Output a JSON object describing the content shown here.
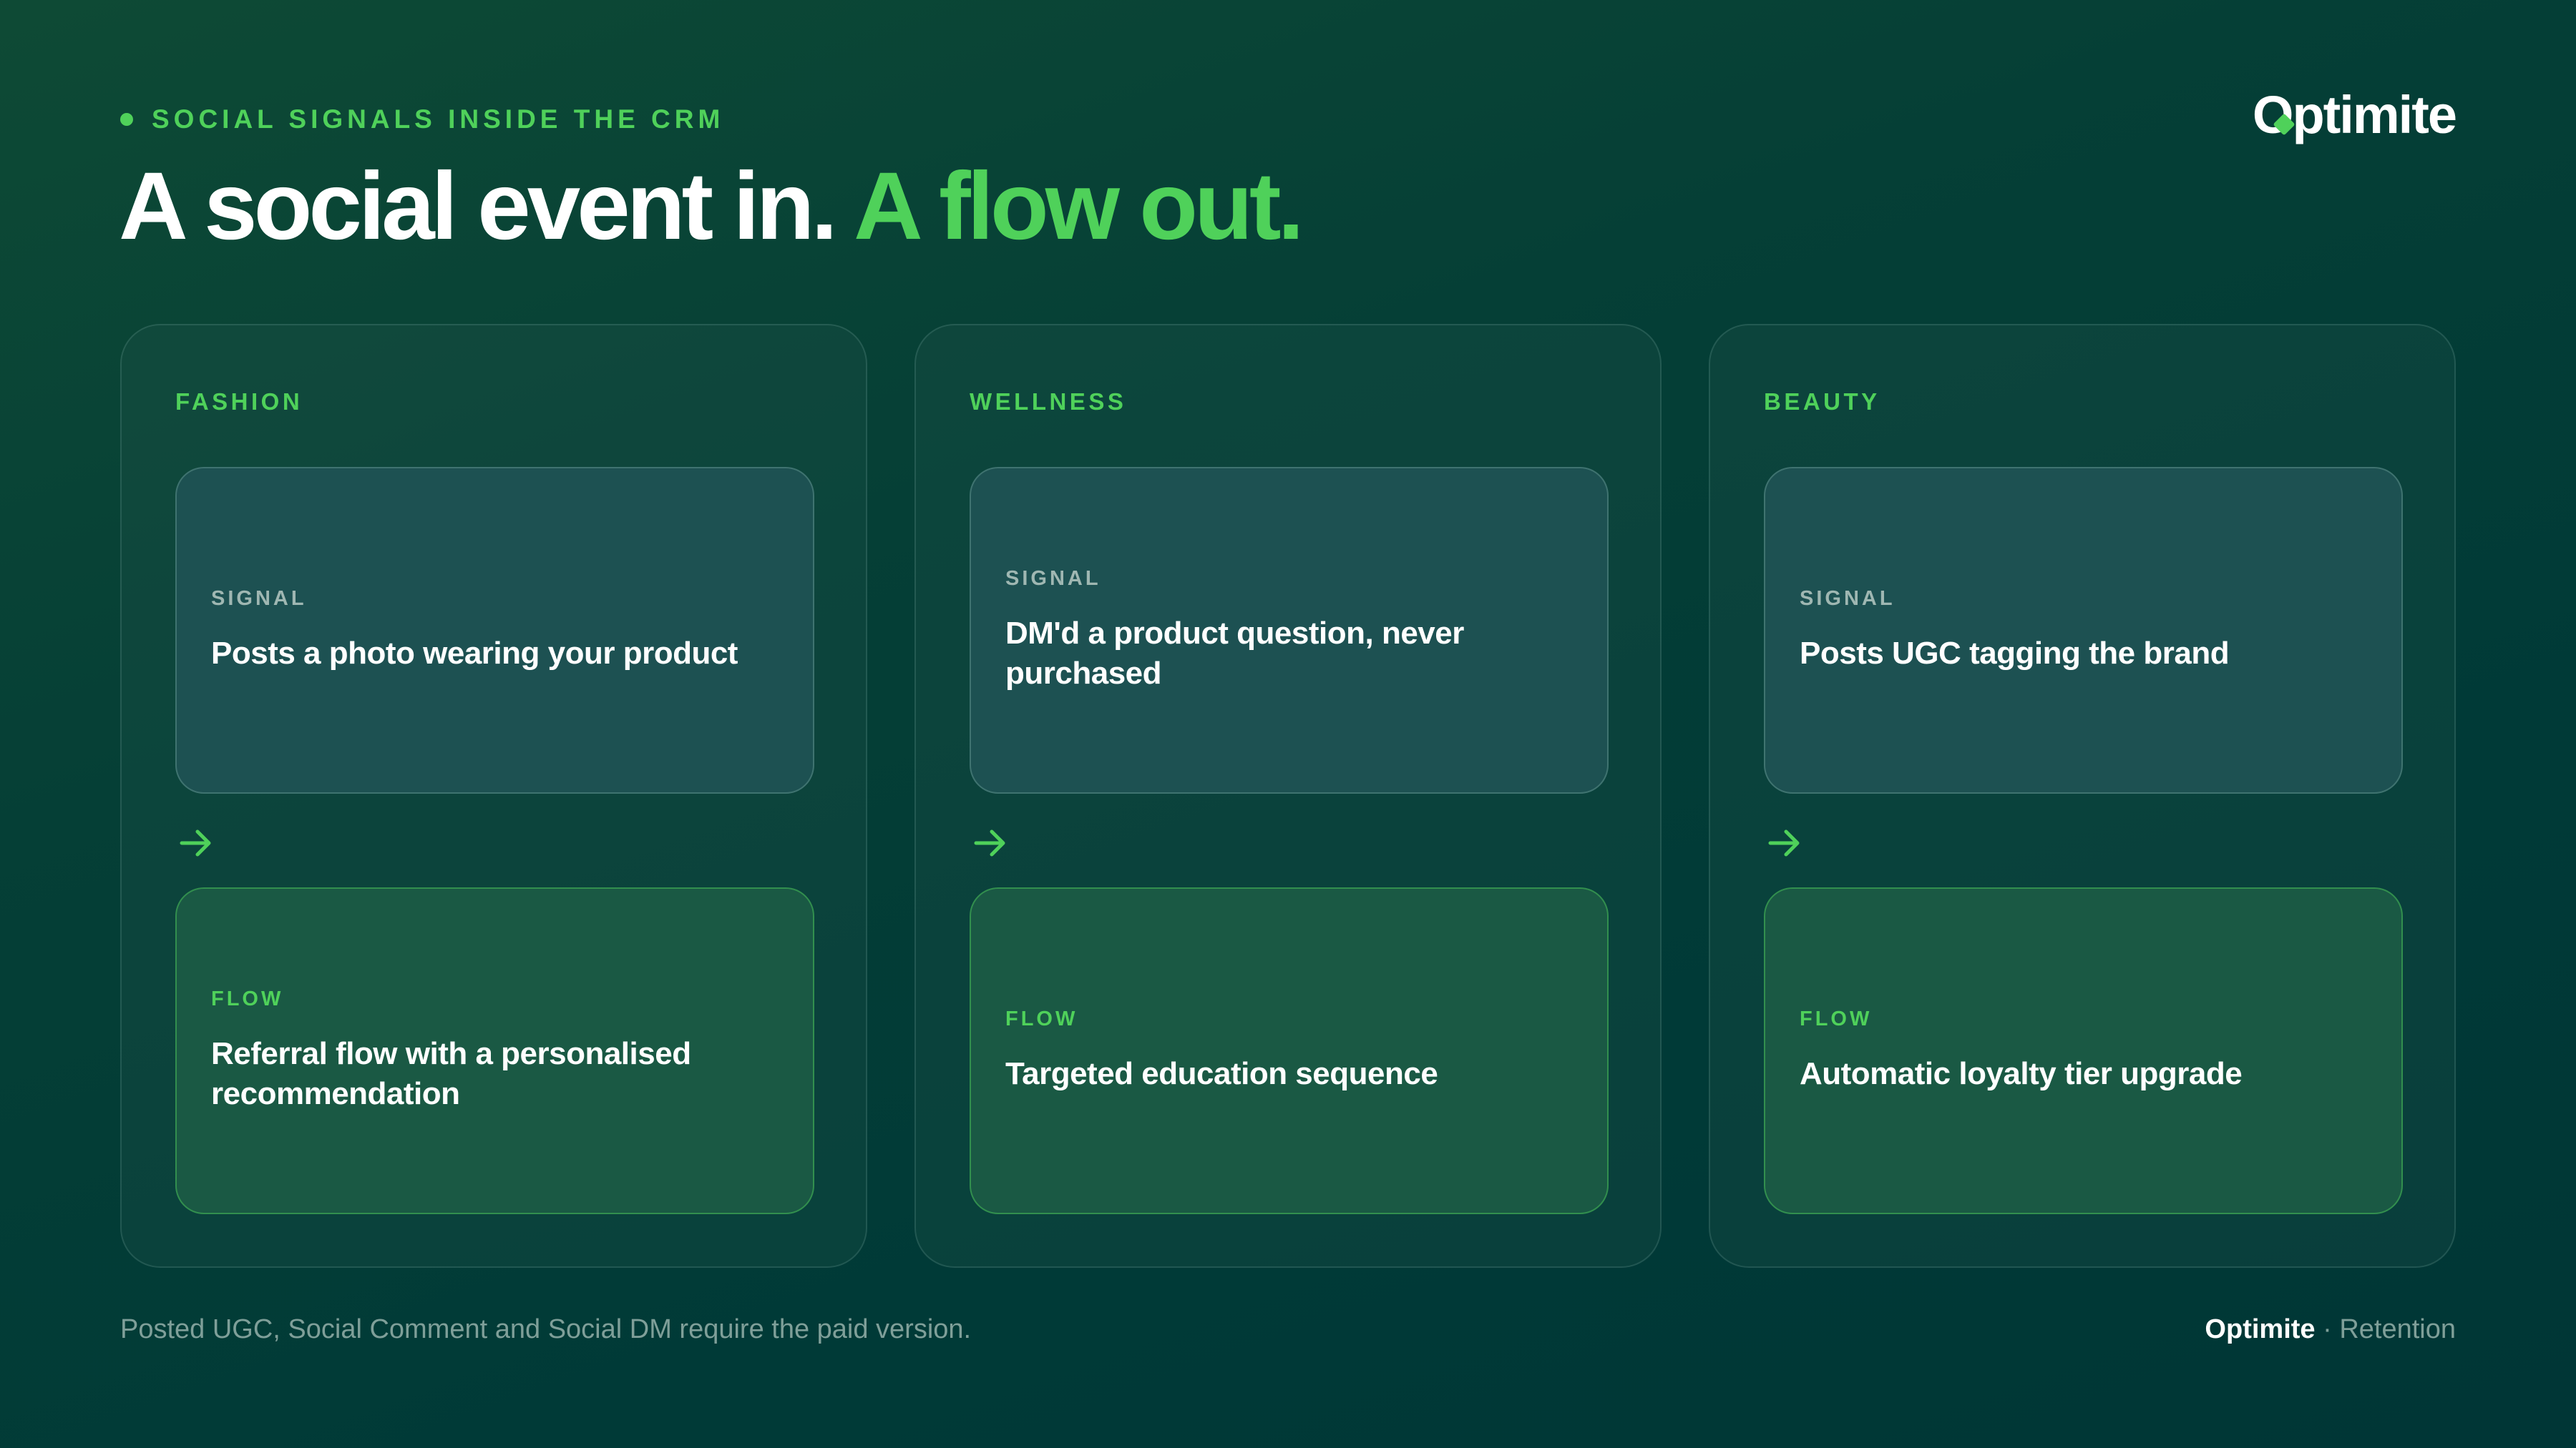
{
  "header": {
    "eyebrow": "SOCIAL SIGNALS INSIDE THE CRM",
    "headline_part1": "A social event in.",
    "headline_part2": "A flow out.",
    "logo_first": "O",
    "logo_rest": "ptimite"
  },
  "columns": [
    {
      "title": "FASHION",
      "signal_label": "SIGNAL",
      "signal_text": "Posts a photo wearing your product",
      "flow_label": "FLOW",
      "flow_text": "Referral flow with a personalised recommendation"
    },
    {
      "title": "WELLNESS",
      "signal_label": "SIGNAL",
      "signal_text": "DM'd a product question, never purchased",
      "flow_label": "FLOW",
      "flow_text": "Targeted education sequence"
    },
    {
      "title": "BEAUTY",
      "signal_label": "SIGNAL",
      "signal_text": "Posts UGC tagging the brand",
      "flow_label": "FLOW",
      "flow_text": "Automatic loyalty tier upgrade"
    }
  ],
  "footer": {
    "note": "Posted UGC, Social Comment and Social DM require the paid version.",
    "brand": "Optimite",
    "separator": "·",
    "section": "Retention"
  },
  "icons": {
    "arrow": "arrow-right-icon",
    "bullet": "dot-icon",
    "logo_mark": "diamond-icon"
  },
  "colors": {
    "accent": "#4fd15a",
    "background": "#003a37",
    "signal_card": "#1d5152",
    "flow_card": "#1a5944",
    "muted_text": "#7f9f99"
  }
}
